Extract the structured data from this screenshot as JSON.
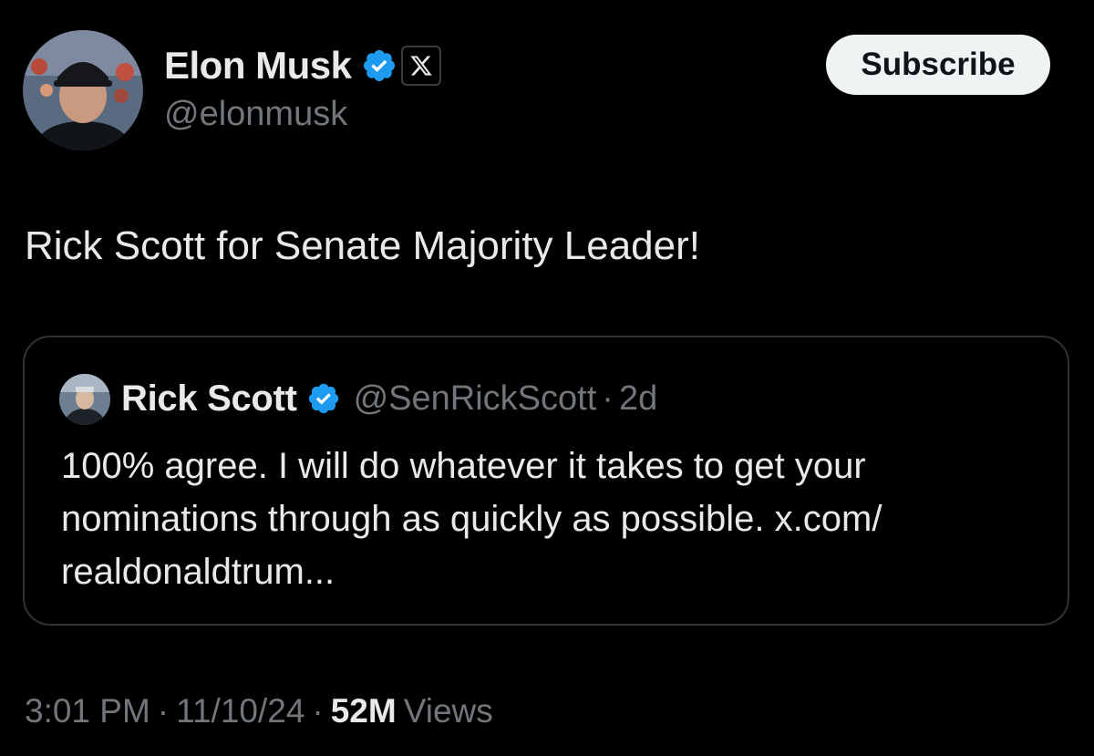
{
  "author": {
    "name": "Elon Musk",
    "handle": "@elonmusk",
    "avatar": "profile-photo"
  },
  "subscribe": {
    "label": "Subscribe"
  },
  "post": {
    "text": "Rick Scott for Senate Majority Leader!"
  },
  "quote": {
    "author_name": "Rick Scott",
    "author_handle": "@SenRickScott",
    "separator": "·",
    "time_ago": "2d",
    "text_lines": [
      "100% agree. I will do whatever it takes to get your",
      "nominations through as quickly as possible. x.com/",
      "realdonaldtrum..."
    ]
  },
  "meta": {
    "time": "3:01 PM",
    "sep": "·",
    "date": "11/10/24",
    "views_count": "52M",
    "views_label": "Views"
  },
  "icons": {
    "verified": "verified-checkmark-icon",
    "affiliation": "x-logo-icon"
  },
  "colors": {
    "background": "#000000",
    "text_primary": "#e7e9ea",
    "text_secondary": "#71767b",
    "verified_blue": "#1d9bf0",
    "quote_border": "#2f3336",
    "button_bg": "#eff3f4",
    "button_text": "#0f1419"
  }
}
